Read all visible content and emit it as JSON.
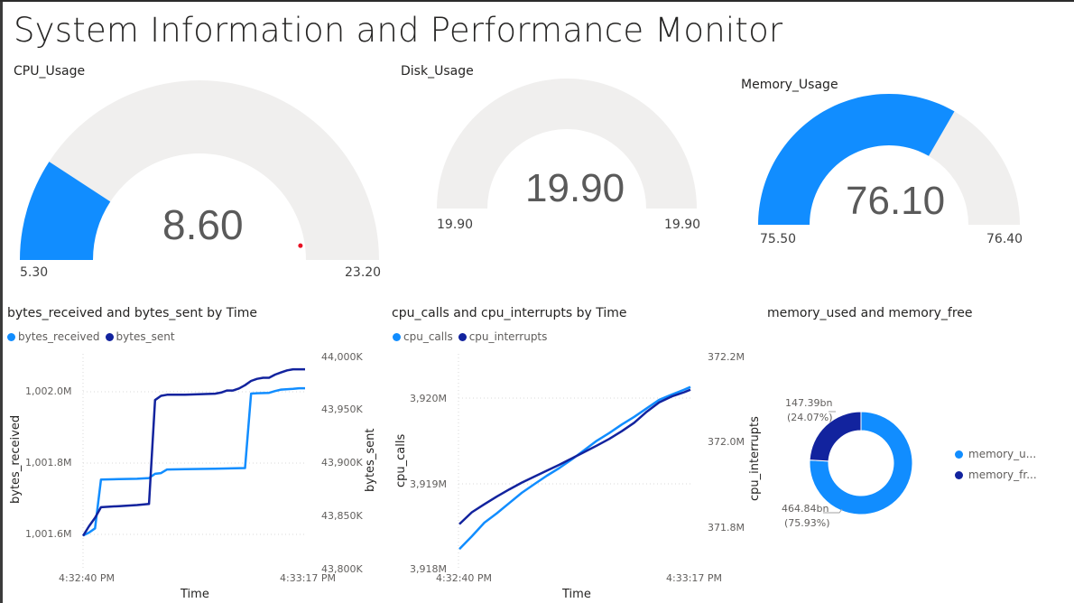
{
  "page": {
    "title": "System Information and Performance Monitor"
  },
  "colors": {
    "light_blue": "#118dff",
    "dark_blue": "#12239e",
    "track": "#f0efee",
    "indicator": "#e81123"
  },
  "gauges": {
    "cpu": {
      "title": "CPU_Usage",
      "value_label": "8.60",
      "min_label": "5.30",
      "max_label": "23.20",
      "value": 8.6,
      "min": 5.3,
      "max": 23.2,
      "target": 22.4
    },
    "disk": {
      "title": "Disk_Usage",
      "value_label": "19.90",
      "min_label": "19.90",
      "max_label": "19.90",
      "value": 19.9,
      "min": 19.9,
      "max": 19.9
    },
    "memory": {
      "title": "Memory_Usage",
      "value_label": "76.10",
      "min_label": "75.50",
      "max_label": "76.40",
      "value": 76.1,
      "min": 75.5,
      "max": 76.4
    }
  },
  "chart_data": [
    {
      "type": "line",
      "title": "bytes_received and bytes_sent by Time",
      "xlabel": "Time",
      "ylabel_left": "bytes_received",
      "ylabel_right": "bytes_sent",
      "x_ticks": [
        "4:32:40 PM",
        "4:33:17 PM"
      ],
      "x_range": [
        0,
        37
      ],
      "y_left_ticks": [
        "1,002.0M",
        "1,001.8M",
        "1,001.6M"
      ],
      "y_left_range": [
        1001500000,
        1002100000
      ],
      "y_right_ticks": [
        "44,000K",
        "43,950K",
        "43,900K",
        "43,850K",
        "43,800K"
      ],
      "y_right_range": [
        43800000,
        44000000
      ],
      "series": [
        {
          "name": "bytes_received",
          "axis": "left",
          "color": "#118dff",
          "x": [
            0,
            1,
            2,
            3,
            6,
            9,
            11,
            12,
            13,
            14,
            17,
            22,
            27,
            28,
            29,
            31,
            32,
            33,
            35,
            36,
            37
          ],
          "y": [
            1001597000,
            1001605000,
            1001617000,
            1001754000,
            1001755000,
            1001756000,
            1001758000,
            1001770000,
            1001772000,
            1001782000,
            1001783000,
            1001784000,
            1001786000,
            1001995000,
            1001996000,
            1001997000,
            1002002000,
            1002006000,
            1002008000,
            1002010000,
            1002010000
          ]
        },
        {
          "name": "bytes_sent",
          "axis": "right",
          "color": "#12239e",
          "x": [
            0,
            1,
            2,
            3,
            6,
            9,
            11,
            12,
            13,
            14,
            17,
            22,
            23,
            24,
            25,
            26,
            27,
            28,
            29,
            30,
            31,
            32,
            33,
            34,
            35,
            36,
            37
          ],
          "y": [
            43831000,
            43840000,
            43848000,
            43858000,
            43859000,
            43860000,
            43861000,
            43959000,
            43963000,
            43964000,
            43964000,
            43965000,
            43966000,
            43968000,
            43968000,
            43970000,
            43973000,
            43977000,
            43979000,
            43980000,
            43980000,
            43983000,
            43985000,
            43987000,
            43988000,
            43988000,
            43988000
          ]
        }
      ]
    },
    {
      "type": "line",
      "title": "cpu_calls and cpu_interrupts by Time",
      "xlabel": "Time",
      "ylabel_left": "cpu_calls",
      "ylabel_right": "cpu_interrupts",
      "x_ticks": [
        "4:32:40 PM",
        "4:33:17 PM"
      ],
      "x_range": [
        0,
        37
      ],
      "y_left_ticks": [
        "3,920M",
        "3,919M",
        "3,918M"
      ],
      "y_left_range": [
        3918000000,
        3920000000
      ],
      "y_right_ticks": [
        "372.2M",
        "372.0M",
        "371.8M"
      ],
      "y_right_range": [
        371800000,
        372200000
      ],
      "series": [
        {
          "name": "cpu_calls",
          "axis": "left",
          "color": "#118dff",
          "x": [
            0,
            2,
            4,
            6,
            8,
            10,
            12,
            14,
            16,
            18,
            20,
            22,
            24,
            26,
            28,
            30,
            32,
            34,
            36,
            37
          ],
          "y": [
            3918230000,
            3918380000,
            3918540000,
            3918650000,
            3918770000,
            3918890000,
            3918990000,
            3919090000,
            3919180000,
            3919280000,
            3919390000,
            3919500000,
            3919590000,
            3919690000,
            3919780000,
            3919880000,
            3919980000,
            3920040000,
            3920100000,
            3920130000
          ]
        },
        {
          "name": "cpu_interrupts",
          "axis": "right",
          "color": "#12239e",
          "x": [
            0,
            2,
            4,
            6,
            8,
            10,
            12,
            14,
            16,
            18,
            20,
            22,
            24,
            26,
            28,
            30,
            32,
            34,
            36,
            37
          ],
          "y": [
            371805000,
            371833000,
            371852000,
            371870000,
            371887000,
            371903000,
            371917000,
            371931000,
            371945000,
            371960000,
            371975000,
            371990000,
            372006000,
            372024000,
            372044000,
            372070000,
            372092000,
            372106000,
            372116000,
            372122000
          ]
        }
      ]
    },
    {
      "type": "pie",
      "title": "memory_used and memory_free",
      "labels": [
        "memory_used",
        "memory_free"
      ],
      "legend_labels": [
        "memory_u...",
        "memory_fr..."
      ],
      "values": [
        464.84,
        147.39
      ],
      "value_labels": [
        "464.84bn",
        "147.39bn"
      ],
      "percent_labels": [
        "(75.93%)",
        "(24.07%)"
      ],
      "colors": [
        "#118dff",
        "#12239e"
      ],
      "donut": true,
      "legend": "right"
    }
  ]
}
